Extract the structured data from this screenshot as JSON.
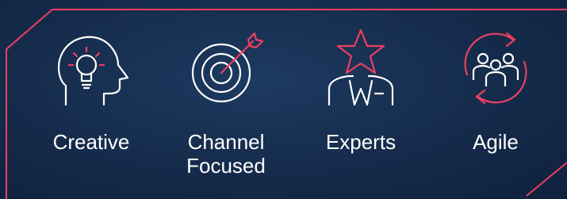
{
  "colors": {
    "accent": "#ef3f5e",
    "background": "#16294a",
    "icon_stroke": "#ffffff",
    "text": "#ffffff"
  },
  "features": [
    {
      "label": "Creative",
      "icon": "lightbulb-head-icon"
    },
    {
      "label": "Channel\nFocused",
      "icon": "target-arrow-icon"
    },
    {
      "label": "Experts",
      "icon": "star-person-icon"
    },
    {
      "label": "Agile",
      "icon": "team-cycle-icon"
    }
  ]
}
